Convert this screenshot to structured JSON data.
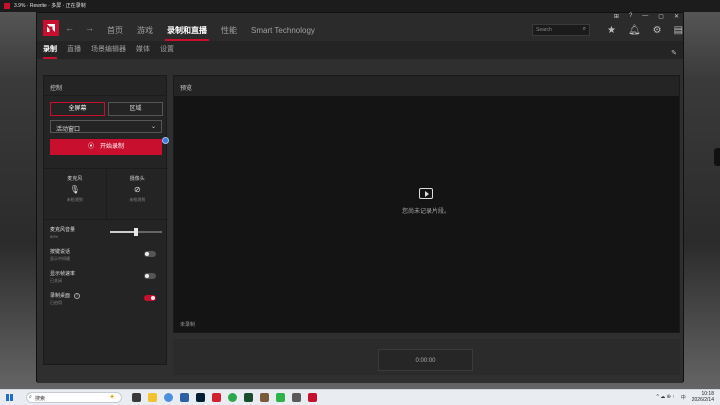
{
  "os": {
    "window_title": "3.9% · Rewrite · 多屏 · 正在录制",
    "taskbar": {
      "search_placeholder": "搜索",
      "time": "10:18",
      "date": "2026/2/14",
      "tray_lang": "中",
      "tray_misc": "^ ☁ ⊕ ↑"
    }
  },
  "app": {
    "nav_back": "←",
    "nav_forward": "→",
    "top_tabs": [
      "首页",
      "游戏",
      "录制和直播",
      "性能",
      "Smart Technology"
    ],
    "active_top_tab": "录制和直播",
    "search_placeholder": "Search",
    "window_controls": [
      "⊞",
      "?",
      "—",
      "▢",
      "✕"
    ],
    "sub_tabs": [
      "录制",
      "直播",
      "场景编辑器",
      "媒体",
      "设置"
    ],
    "active_sub_tab": "录制",
    "control_panel": {
      "header": "控制",
      "capture_mode_options": [
        "全屏幕",
        "区域"
      ],
      "capture_mode_selected": "全屏幕",
      "window_select_value": "活动窗口",
      "record_button_label": "开始录制",
      "microphone": {
        "label": "麦克风",
        "status": "未检测到"
      },
      "camera": {
        "label": "摄像头",
        "status": "未检测到"
      },
      "mic_volume": {
        "label": "麦克风音量",
        "value": "50%",
        "level": 0.5
      },
      "push_to_talk": {
        "label": "按键说话",
        "status": "显示中间键",
        "on": false
      },
      "show_fps": {
        "label": "显示帧速率",
        "status": "已关闭",
        "on": false
      },
      "record_desktop": {
        "label": "录制桌面",
        "status": "已启用",
        "on": true
      }
    },
    "preview": {
      "header": "预览",
      "empty_text": "您尚未记录片段。",
      "status": "未录制",
      "timer": "0:00:00"
    }
  },
  "colors": {
    "accent": "#c8102e",
    "panel_bg": "#242424",
    "preview_bg": "#141414"
  }
}
